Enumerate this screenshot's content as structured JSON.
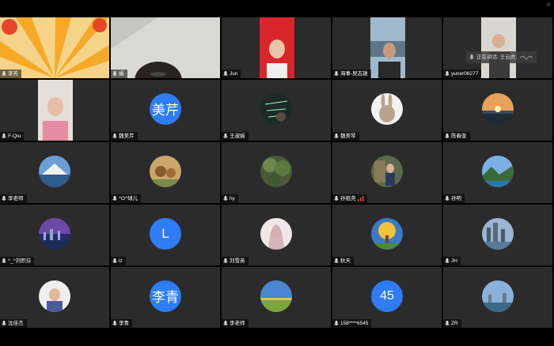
{
  "window": {
    "corner_glyph": "⊙"
  },
  "speaking_indicator": {
    "label": "正在讲话: 王云虎;"
  },
  "participants": [
    {
      "name": "李芳"
    },
    {
      "name": "娟"
    },
    {
      "name": "Jun"
    },
    {
      "name": "海事-吴志雄"
    },
    {
      "name": "yuner06277"
    },
    {
      "name": "F-Qiu"
    },
    {
      "name": "魏美芹"
    },
    {
      "name": "王淑娟"
    },
    {
      "name": "魏美琴"
    },
    {
      "name": "陈春奎"
    },
    {
      "name": "李老师"
    },
    {
      "name": "^O^球儿"
    },
    {
      "name": "hy"
    },
    {
      "name": "孙祖尧"
    },
    {
      "name": "孙明"
    },
    {
      "name": "^_^刘积芬"
    },
    {
      "name": "lz"
    },
    {
      "name": "刘雪英"
    },
    {
      "name": "秋天"
    },
    {
      "name": "JH"
    },
    {
      "name": "沈佳杰"
    },
    {
      "name": "李青"
    },
    {
      "name": "李老师"
    },
    {
      "name": "158****6545"
    },
    {
      "name": "ZR"
    }
  ],
  "letter_avatars": {
    "wei_meiqin": "美芹",
    "lz": "L",
    "li_qing": "李青",
    "num": "45"
  },
  "colors": {
    "avatar_blue": "#2e7cf6",
    "tile_bg": "#2b2b2b"
  }
}
